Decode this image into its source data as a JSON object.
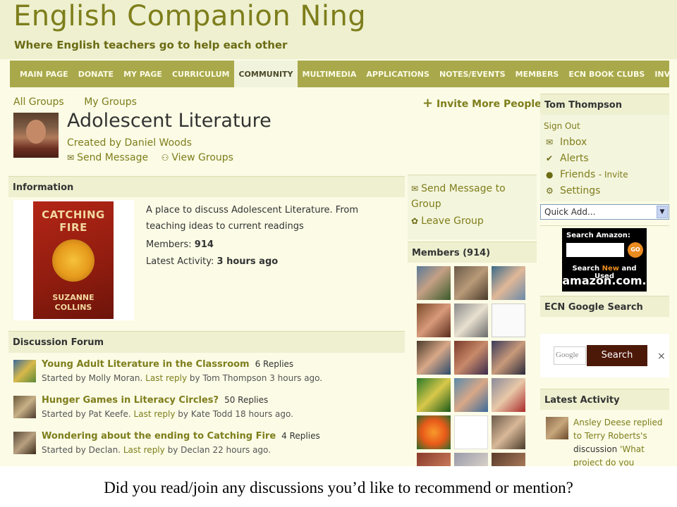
{
  "site": {
    "title": "English Companion Ning",
    "tagline": "Where English teachers go to help each other"
  },
  "nav": [
    "MAIN PAGE",
    "DONATE",
    "MY PAGE",
    "CURRICULUM",
    "COMMUNITY",
    "MULTIMEDIA",
    "APPLICATIONS",
    "NOTES/EVENTS",
    "MEMBERS",
    "ECN BOOK CLUBS",
    "INVITE"
  ],
  "nav_active": "COMMUNITY",
  "top_links": {
    "all_groups": "All Groups",
    "my_groups": "My Groups",
    "invite_more": "Invite More People"
  },
  "group": {
    "title": "Adolescent Literature",
    "created_by": "Created by Daniel Woods",
    "send_message": "Send Message",
    "view_groups": "View Groups"
  },
  "information": {
    "heading": "Information",
    "book_title": "CATCHING FIRE",
    "book_author": "SUZANNE COLLINS",
    "description": "A place to discuss Adolescent Literature. From teaching ideas to current readings",
    "members_label": "Members:",
    "members_value": "914",
    "activity_label": "Latest Activity:",
    "activity_value": "3 hours ago"
  },
  "forum": {
    "heading": "Discussion Forum",
    "topics": [
      {
        "title": "Young Adult Literature in the Classroom",
        "replies": "6 Replies",
        "started": "Started by Molly Moran.",
        "last_reply": "Last reply",
        "by": "by Tom Thompson 3 hours ago."
      },
      {
        "title": "Hunger Games in Literacy Circles?",
        "replies": "50 Replies",
        "started": "Started by Pat Keefe.",
        "last_reply": "Last reply",
        "by": "by Kate Todd 18 hours ago."
      },
      {
        "title": "Wondering about the ending to Catching Fire",
        "replies": "4 Replies",
        "started": "Started by Declan.",
        "last_reply": "Last reply",
        "by": "by Declan 22 hours ago."
      }
    ]
  },
  "group_actions": {
    "send_message_to_group": "Send Message to Group",
    "leave_group": "Leave Group"
  },
  "members": {
    "heading": "Members (914)"
  },
  "user": {
    "name": "Tom Thompson",
    "sign_out": "Sign Out",
    "inbox": "Inbox",
    "alerts": "Alerts",
    "friends": "Friends",
    "friends_invite": "- Invite",
    "settings": "Settings",
    "quick_add": "Quick Add..."
  },
  "amazon": {
    "search_label": "Search Amazon:",
    "go": "GO",
    "search_new_used_prefix": "Search",
    "search_new_used_new": "New",
    "search_new_used_suffix": "and Used",
    "logo": "amazon.com."
  },
  "google": {
    "heading": "ECN Google Search",
    "placeholder": "Google",
    "button": "Search",
    "close": "×"
  },
  "latest_activity": {
    "heading": "Latest Activity",
    "actor": "Ansley Deese",
    "verb": "replied to",
    "target": "Terry Roberts's",
    "noun": "discussion",
    "topic": "'What project do you"
  },
  "caption": "Did you read/join any discussions you’d like to recommend or mention?",
  "colors": {
    "brand": "#7e7e1c",
    "nav_bg": "#a9a94c",
    "page_bg": "#fbfbe6",
    "panel_bg": "#eef0d0"
  }
}
